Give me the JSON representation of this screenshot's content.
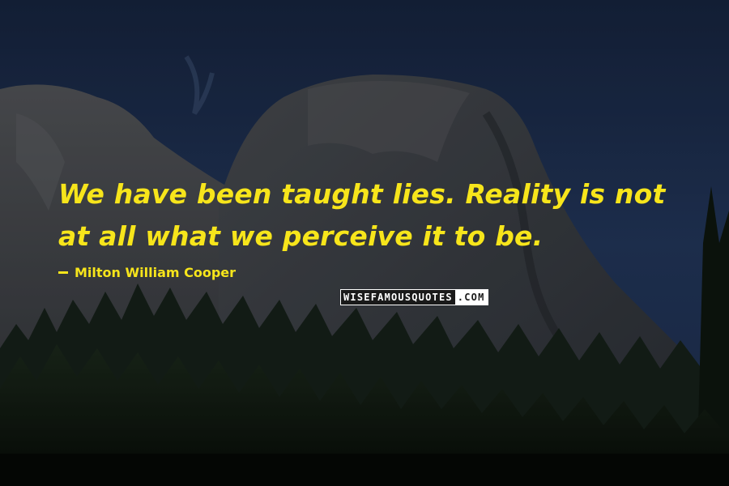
{
  "quote": {
    "line1": "We have been taught lies. Reality is not",
    "line2": "at all what we perceive it to be."
  },
  "author": {
    "name": "Milton William Cooper"
  },
  "watermark": {
    "part1": "WISEFAMOUSQUOTES",
    "part2": ".COM"
  },
  "colors": {
    "text": "#f7e51b",
    "sky": "#1b2a4a",
    "forest": "#0d140d"
  },
  "background": {
    "icon": "mountain-forest-night-photo"
  }
}
